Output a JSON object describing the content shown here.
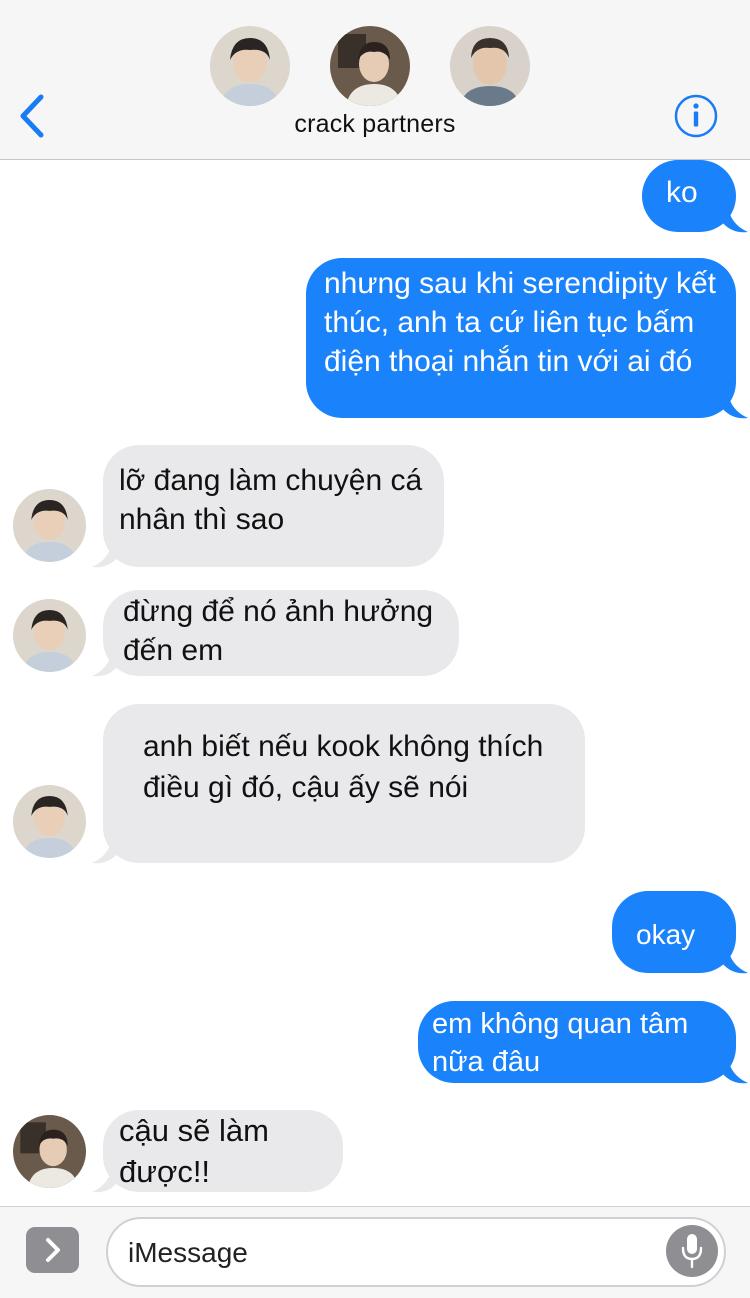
{
  "header": {
    "group_name": "crack partners",
    "participants": [
      {
        "avatar": "avatar-1"
      },
      {
        "avatar": "avatar-2"
      },
      {
        "avatar": "avatar-3"
      }
    ],
    "back_icon": "chevron-left-icon",
    "info_icon": "info-icon"
  },
  "colors": {
    "sent_bubble": "#1a82fb",
    "received_bubble": "#e9e9eb",
    "accent": "#1a7cf5",
    "header_bg": "#f6f6f7"
  },
  "messages": [
    {
      "direction": "sent",
      "text": "ko"
    },
    {
      "direction": "sent",
      "text": "nhưng sau khi serendipity kết thúc, anh ta cứ liên tục bấm điện thoại nhắn tin với ai đó"
    },
    {
      "direction": "received",
      "text": "lỡ đang làm chuyện cá nhân thì sao"
    },
    {
      "direction": "received",
      "text": "đừng để nó ảnh hưởng đến em"
    },
    {
      "direction": "received",
      "text": "anh biết nếu kook không thích điều gì đó, cậu ấy sẽ nói"
    },
    {
      "direction": "sent",
      "text": "okay"
    },
    {
      "direction": "sent",
      "text": "em không quan tâm nữa đâu"
    },
    {
      "direction": "received",
      "text": "cậu sẽ làm được!!"
    }
  ],
  "composer": {
    "placeholder": "iMessage",
    "apps_icon": "chevron-right-icon",
    "mic_icon": "microphone-icon"
  }
}
